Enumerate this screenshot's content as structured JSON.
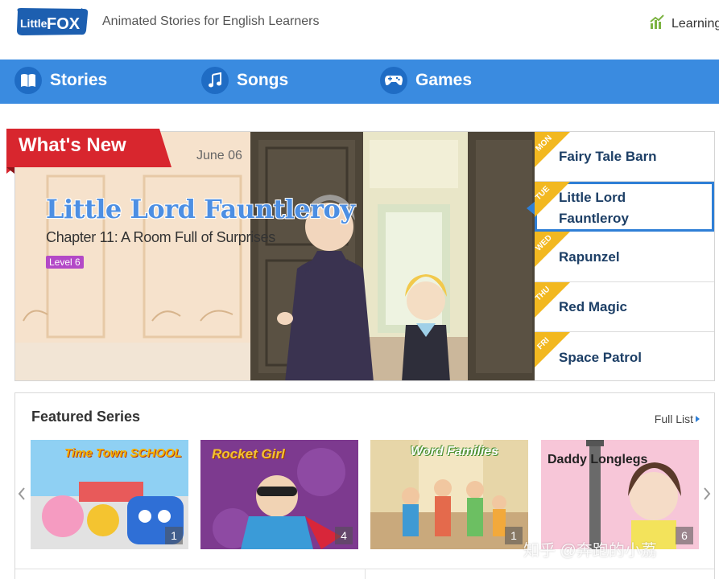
{
  "header": {
    "logo_text_top": "Little",
    "logo_text_main": "FOX",
    "tagline": "Animated Stories for English Learners",
    "learning_label": "Learning"
  },
  "nav": {
    "items": [
      {
        "label": "Stories",
        "icon": "book-icon"
      },
      {
        "label": "Songs",
        "icon": "music-note-icon"
      },
      {
        "label": "Games",
        "icon": "gamepad-icon"
      }
    ]
  },
  "whats_new": {
    "ribbon_label": "What's New",
    "date": "June 06",
    "story_title": "Little Lord Fauntleroy",
    "chapter": "Chapter 11: A Room Full of Surprises",
    "level": "Level 6",
    "schedule": [
      {
        "day": "MON",
        "title": "Fairy Tale Barn"
      },
      {
        "day": "TUE",
        "title_line1": "Little Lord",
        "title_line2": "Fauntleroy",
        "active": true
      },
      {
        "day": "WED",
        "title": "Rapunzel"
      },
      {
        "day": "THU",
        "title": "Red Magic"
      },
      {
        "day": "FRI",
        "title": "Space Patrol"
      }
    ]
  },
  "featured": {
    "title": "Featured Series",
    "full_list_label": "Full List",
    "series": [
      {
        "brand": "Time Town SCHOOL",
        "count": "1"
      },
      {
        "brand": "Rocket Girl",
        "count": "4"
      },
      {
        "brand": "Word Families",
        "count": "1"
      },
      {
        "brand": "Daddy Longlegs",
        "count": "6"
      }
    ]
  },
  "watermark": "知乎 @奔跑的小荔",
  "colors": {
    "nav_blue": "#3a8be0",
    "ribbon_red": "#d8262e",
    "day_tag_gold": "#f2b820",
    "active_border": "#2f7fd6",
    "level_purple": "#b349c7"
  }
}
